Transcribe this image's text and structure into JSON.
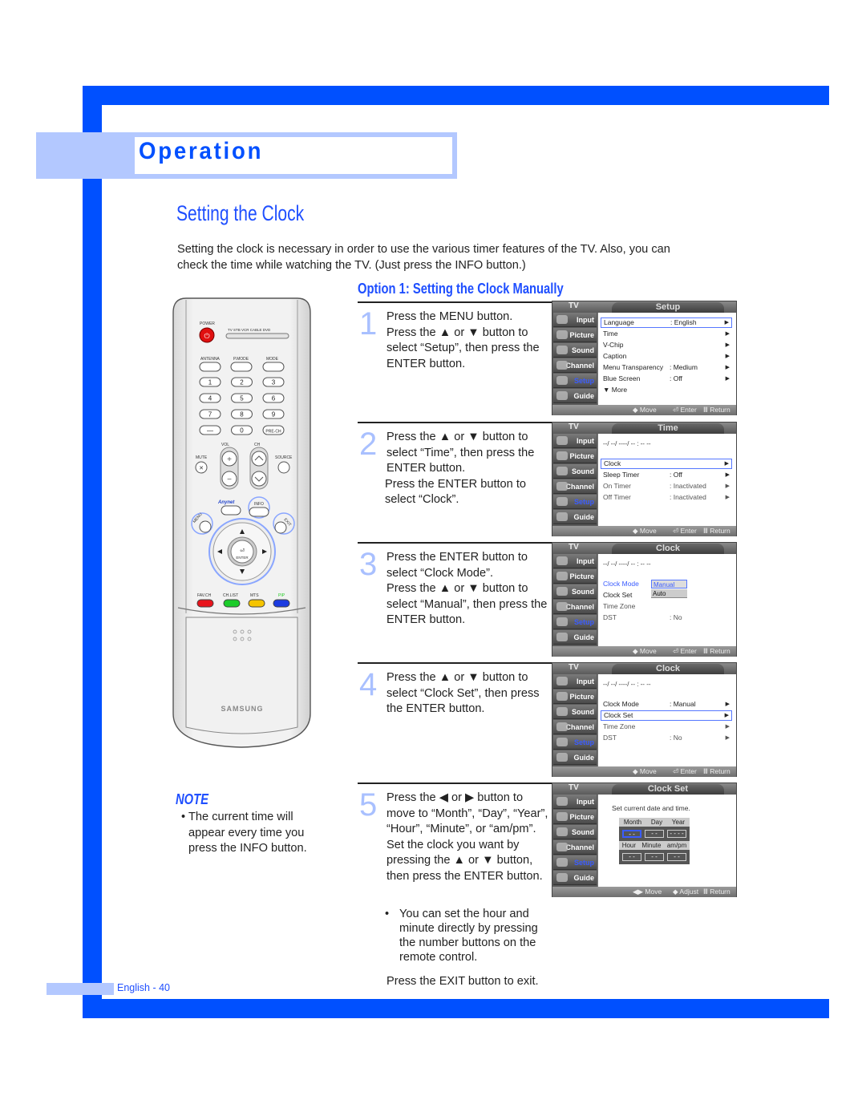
{
  "header": {
    "section": "Operation"
  },
  "page": {
    "title": "Setting the Clock",
    "intro": "Setting the clock is necessary in order to use the various timer features of the TV. Also, you can check the time while watching the TV. (Just press the INFO button.)",
    "option_title": "Option 1: Setting the Clock Manually",
    "page_number": "English - 40"
  },
  "steps": [
    {
      "num": "1",
      "lines": [
        "Press the MENU button.",
        "Press the ▲ or ▼ button to select “Setup”, then press the ENTER button."
      ]
    },
    {
      "num": "2",
      "lines": [
        "Press the ▲ or ▼ button to select “Time”, then press the ENTER button.",
        "Press the ENTER button to select “Clock”."
      ]
    },
    {
      "num": "3",
      "lines": [
        "Press the ENTER button to select “Clock Mode”.",
        "Press the ▲ or ▼ button to select “Manual”, then press the ENTER button."
      ]
    },
    {
      "num": "4",
      "lines": [
        "Press the ▲ or ▼ button to select “Clock Set”, then press the ENTER button."
      ]
    },
    {
      "num": "5",
      "lines": [
        "Press the ◀ or ▶ button to move to “Month”, “Day”, “Year”, “Hour”, “Minute”, or “am/pm”. Set the clock you want by pressing the ▲ or ▼ button, then press the ENTER button."
      ]
    }
  ],
  "step5_bullet": "You can set the hour and minute directly by pressing the number buttons on the remote control.",
  "exit_text": "Press the EXIT button to exit.",
  "note": {
    "title": "NOTE",
    "bullet": "•",
    "text": "The current time will appear every time you press the INFO button."
  },
  "osd_common": {
    "tv": "TV",
    "nav": [
      "Input",
      "Picture",
      "Sound",
      "Channel",
      "Setup",
      "Guide"
    ],
    "footer": {
      "move": "◆ Move",
      "enter": "⏎ Enter",
      "return": "Ⅲ Return",
      "lr_move": "◀▶ Move",
      "adjust": "◆ Adjust"
    },
    "date_placeholder": "--/ --/ ----/ -- : -- --",
    "arrow": "▶"
  },
  "osd": [
    {
      "title": "Setup",
      "rows": [
        {
          "label": "Language",
          "value": ": English",
          "arrow": true,
          "selected": true
        },
        {
          "label": "Time",
          "value": "",
          "arrow": true
        },
        {
          "label": "V-Chip",
          "value": "",
          "arrow": true
        },
        {
          "label": "Caption",
          "value": "",
          "arrow": true
        },
        {
          "label": "Menu Transparency",
          "value": ": Medium",
          "arrow": true
        },
        {
          "label": "Blue Screen",
          "value": ": Off",
          "arrow": true
        },
        {
          "label": "▼ More",
          "value": "",
          "arrow": false
        }
      ]
    },
    {
      "title": "Time",
      "rows": [
        {
          "label": "Clock",
          "value": "",
          "arrow": true,
          "selected": true
        },
        {
          "label": "Sleep Timer",
          "value": ": Off",
          "arrow": true
        },
        {
          "label": "On Timer",
          "value": ": Inactivated",
          "arrow": true
        },
        {
          "label": "Off Timer",
          "value": ": Inactivated",
          "arrow": true
        }
      ]
    },
    {
      "title": "Clock",
      "rows": [
        {
          "label": "Clock Mode",
          "value": ""
        },
        {
          "label": "Clock Set",
          "value": ""
        },
        {
          "label": "Time Zone",
          "value": ""
        },
        {
          "label": "DST",
          "value": ": No"
        }
      ],
      "dropdown": [
        "Manual",
        "Auto"
      ]
    },
    {
      "title": "Clock",
      "rows": [
        {
          "label": "Clock Mode",
          "value": ": Manual",
          "arrow": true
        },
        {
          "label": "Clock Set",
          "value": "",
          "arrow": true,
          "selected": true
        },
        {
          "label": "Time Zone",
          "value": "",
          "arrow": true
        },
        {
          "label": "DST",
          "value": ": No",
          "arrow": true
        }
      ]
    },
    {
      "title": "Clock Set",
      "caption": "Set current date and time.",
      "date_labels": [
        "Month",
        "Day",
        "Year"
      ],
      "time_labels": [
        "Hour",
        "Minute",
        "am/pm"
      ],
      "date_values": [
        "- -",
        "- -",
        "- - - -"
      ],
      "time_values": [
        "- -",
        "- -",
        "- -"
      ]
    }
  ],
  "remote": {
    "power": "POWER",
    "sources": "TV  STB  VCR  CABLE  DVD",
    "top_row": [
      "ANTENNA",
      "P.MODE",
      "MODE"
    ],
    "digits": [
      "1",
      "2",
      "3",
      "4",
      "5",
      "6",
      "7",
      "8",
      "9",
      "—",
      "0",
      "PRE-CH"
    ],
    "vol": "VOL",
    "ch": "CH",
    "mute": "MUTE",
    "source": "SOURCE",
    "anynet": "Anynet",
    "info": "INFO",
    "menu": "MENU",
    "exit": "EXIT",
    "enter": "ENTER",
    "color_labels": [
      "FAV.CH",
      "CH.LIST",
      "MTS",
      "PIP"
    ],
    "color_values": [
      "#e8141c",
      "#1bcc2a",
      "#f5c400",
      "#1b3be0"
    ],
    "brand": "SAMSUNG"
  },
  "colors": {
    "brand_blue": "#0050ff",
    "light_blue": "#b3c8ff",
    "title_blue": "#1f4fff"
  }
}
